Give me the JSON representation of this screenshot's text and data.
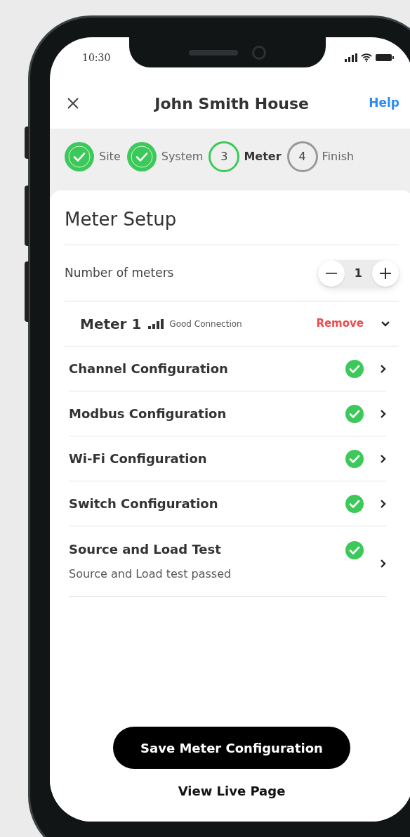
{
  "status_bar": {
    "time": "10:30"
  },
  "header": {
    "title": "John Smith House",
    "help": "Help"
  },
  "steps": [
    {
      "label": "Site",
      "completed": true,
      "current": false
    },
    {
      "label": "System",
      "completed": true,
      "current": false
    },
    {
      "label": "Meter",
      "number": "3",
      "completed": false,
      "current": true
    },
    {
      "label": "Finish",
      "number": "4",
      "completed": false,
      "current": false
    }
  ],
  "section_title": "Meter Setup",
  "meter_count": {
    "label": "Number of meters",
    "value": "1"
  },
  "meter": {
    "name": "Meter 1",
    "connection": "Good Connection",
    "remove": "Remove",
    "expanded": true
  },
  "config_items": [
    {
      "title": "Channel Configuration",
      "complete": true
    },
    {
      "title": "Modbus Configuration",
      "complete": true
    },
    {
      "title": "Wi-Fi Configuration",
      "complete": true
    },
    {
      "title": "Switch Configuration",
      "complete": true
    },
    {
      "title": "Source and Load Test",
      "subtitle": "Source and Load test passed",
      "complete": true
    }
  ],
  "primary_button": "Save Meter Configuration",
  "secondary_link": "View Live Page"
}
